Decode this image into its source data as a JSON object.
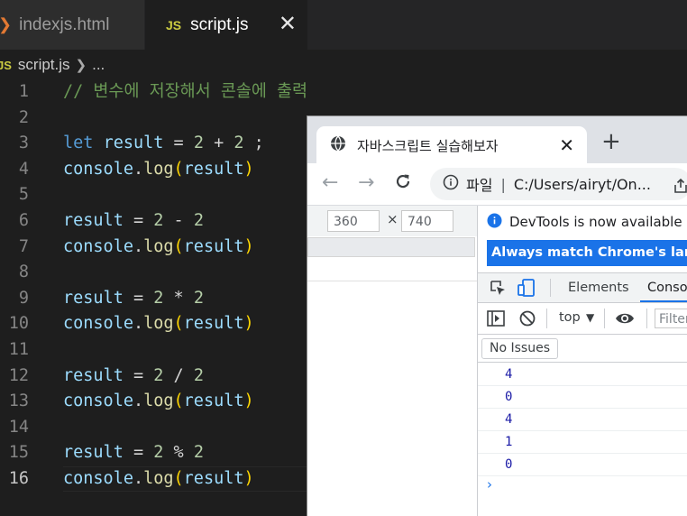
{
  "vscode": {
    "tabs": [
      {
        "label": "indexjs.html",
        "icon": "html-icon"
      },
      {
        "label": "script.js",
        "icon": "js-icon",
        "badge": "JS",
        "active": true
      }
    ],
    "breadcrumb": {
      "file": "script.js",
      "badge": "JS",
      "rest": "..."
    },
    "active_line": 16,
    "lines": [
      {
        "n": "1"
      },
      {
        "n": "2"
      },
      {
        "n": "3"
      },
      {
        "n": "4"
      },
      {
        "n": "5"
      },
      {
        "n": "6"
      },
      {
        "n": "7"
      },
      {
        "n": "8"
      },
      {
        "n": "9"
      },
      {
        "n": "10"
      },
      {
        "n": "11"
      },
      {
        "n": "12"
      },
      {
        "n": "13"
      },
      {
        "n": "14"
      },
      {
        "n": "15"
      },
      {
        "n": "16"
      }
    ],
    "code": {
      "l1": "// 변수에 저장해서 콘솔에 출력",
      "kw_let": "let",
      "var_result": "result",
      "eq": " = ",
      "two": "2",
      "plus": " + ",
      "minus": " - ",
      "mul": " * ",
      "div": " / ",
      "mod": " % ",
      "semi": " ;",
      "console": "console",
      "dot": ".",
      "log": "log",
      "lp": "(",
      "rp": ")"
    }
  },
  "chrome": {
    "tab_title": "자바스크립트 실습해보자",
    "new_tab": "+",
    "close": "✕",
    "address": {
      "prefix": "파일",
      "separator": "|",
      "url": "C:/Users/airyt/On..."
    },
    "viewport": {
      "width": "360",
      "height": "740",
      "x": "×"
    },
    "devtools": {
      "notice": "DevTools is now available in Ko",
      "lang_button": "Always match Chrome's languag",
      "tabs": {
        "elements": "Elements",
        "console": "Consol"
      },
      "context": "top",
      "filter_placeholder": "Filter",
      "issues": "No Issues",
      "output": [
        "4",
        "0",
        "4",
        "1",
        "0"
      ],
      "prompt": "›"
    }
  }
}
